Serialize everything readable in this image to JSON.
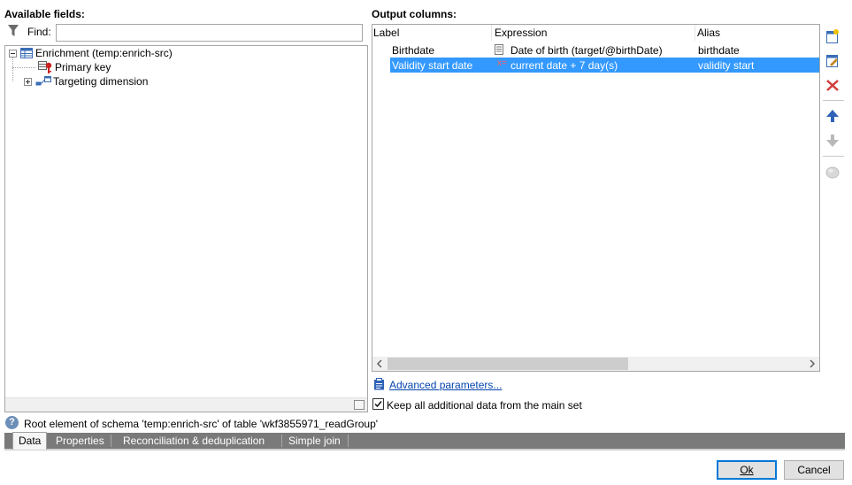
{
  "left_panel": {
    "title": "Available fields:",
    "find_label": "Find:",
    "find_value": "",
    "tree": [
      {
        "label": "Enrichment (temp:enrich-src)",
        "icon": "table-icon",
        "expanded": true
      },
      {
        "label": "Primary key",
        "icon": "primary-key-icon"
      },
      {
        "label": "Targeting dimension",
        "icon": "link-icon",
        "expanded": false
      }
    ]
  },
  "right_panel": {
    "title": "Output columns:",
    "columns": [
      "Label",
      "Expression",
      "Alias"
    ],
    "rows": [
      {
        "label": "Birthdate",
        "expression": "Date of birth (target/@birthDate)",
        "alias": "birthdate",
        "expr_icon": "field-icon",
        "selected": false
      },
      {
        "label": "Validity start date",
        "expression": "current date + 7 day(s)",
        "alias": "validity start",
        "expr_icon": "formula-icon",
        "selected": true
      }
    ],
    "advanced_link": "Advanced parameters...",
    "keep_checkbox": {
      "label": "Keep all additional data from the main set",
      "checked": true
    }
  },
  "toolbar": {
    "buttons": [
      "add-icon",
      "edit-icon",
      "delete-icon",
      "move-up-icon",
      "move-down-icon",
      "disabled-circle-icon"
    ]
  },
  "status": {
    "text": "Root element of schema 'temp:enrich-src' of table 'wkf3855971_readGroup'"
  },
  "tabs": [
    {
      "label": "Data",
      "active": true
    },
    {
      "label": "Properties",
      "active": false
    },
    {
      "label": "Reconciliation & deduplication",
      "active": false
    },
    {
      "label": "Simple join",
      "active": false
    }
  ],
  "buttons": {
    "ok": "Ok",
    "cancel": "Cancel"
  },
  "colors": {
    "selection": "#3399ff",
    "link": "#0645ad",
    "tabbar": "#7a7a7a"
  }
}
